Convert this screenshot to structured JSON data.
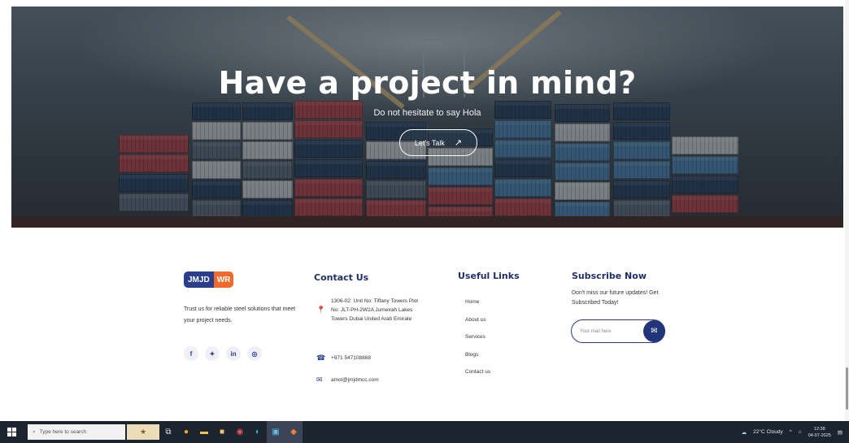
{
  "hero": {
    "title": "Have a project in mind?",
    "subtitle": "Do not hesitate to say Hola",
    "cta_label": "Let's Talk",
    "cta_icon": "arrow-up-right-icon"
  },
  "brand": {
    "logo_part1": "JMJD",
    "logo_part2": "WR",
    "colors": {
      "navy": "#2a3e8e",
      "orange": "#f06a2a",
      "heading": "#1f2f6b"
    }
  },
  "about": {
    "text": "Trust us for reliable steel solutions that meet your project needs.",
    "socials": [
      {
        "name": "facebook-icon",
        "glyph": "f"
      },
      {
        "name": "twitter-icon",
        "glyph": "🐦"
      },
      {
        "name": "linkedin-icon",
        "glyph": "in"
      },
      {
        "name": "instagram-icon",
        "glyph": "◎"
      }
    ]
  },
  "contact": {
    "heading": "Contact Us",
    "address": "1306-02: Unit No: Tiffany Towers Plot No: JLT-PH-2W2A Jumeirah Lakes Towers Dubai United Arab Emirate",
    "phone": "+971 547108868",
    "email": "amol@jmjdmcc.com"
  },
  "links": {
    "heading": "Useful Links",
    "items": [
      "Home",
      "About us",
      "Services",
      "Blogs",
      "Contact us"
    ]
  },
  "subscribe": {
    "heading": "Subscribe Now",
    "text": "Don't miss our future updates! Get Subscribed Today!",
    "placeholder": "Your mail here",
    "button_icon": "mail-send-icon"
  },
  "taskbar": {
    "search_placeholder": "Type here to search",
    "weather": "22°C Cloudy",
    "time": "12:38",
    "date": "04-07-2025"
  }
}
